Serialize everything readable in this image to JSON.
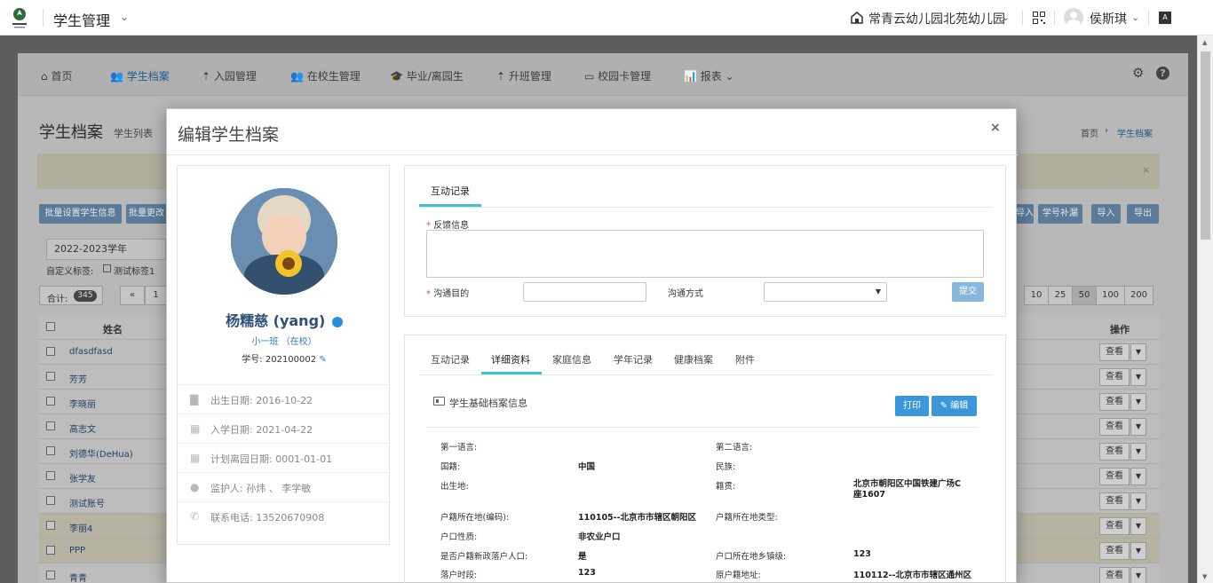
{
  "topbar": {
    "app_title": "学生管理",
    "school": "常青云幼儿园北苑幼儿园",
    "user": "侯斯琪"
  },
  "nav": {
    "items": [
      "首页",
      "学生档案",
      "入园管理",
      "在校生管理",
      "毕业/离园生",
      "升班管理",
      "校园卡管理",
      "报表"
    ]
  },
  "page": {
    "title": "学生档案",
    "subtitle": "学生列表",
    "breadcrumb_home": "首页",
    "breadcrumb_current": "学生档案",
    "btn_batch_set": "批量设置学生信息",
    "btn_batch_change": "批量更改",
    "btn_import_left": "导入",
    "btn_student_no": "学号补漏",
    "btn_import": "导入",
    "btn_export": "导出",
    "year_select": "2022-2023学年",
    "tag_label": "自定义标签:",
    "tag_option": "测试标签1",
    "total_label": "合计:",
    "total_count": "345",
    "page_prev": "«",
    "page_num": "1",
    "page_sizes": [
      "10",
      "25",
      "50",
      "100",
      "200"
    ],
    "col_name": "姓名",
    "col_action": "操作",
    "view_label": "查看",
    "students": [
      "dfasdfasd",
      "芳芳",
      "李晓丽",
      "高志文",
      "刘德华(DeHua)",
      "张学友",
      "测试账号",
      "李丽4",
      "PPP",
      "青青"
    ]
  },
  "modal": {
    "title": "编辑学生档案",
    "close": "×",
    "student": {
      "name": "杨糯慈 (yang)",
      "class": "小一班 （在校）",
      "no_label": "学号:",
      "no": "202100002",
      "birth_label": "出生日期:",
      "birth": "2016-10-22",
      "enroll_label": "入学日期:",
      "enroll": "2021-04-22",
      "leave_label": "计划离园日期:",
      "leave": "0001-01-01",
      "guardian_label": "监护人:",
      "guardian": "孙炜 、 李学敏",
      "phone_label": "联系电话:",
      "phone": "13520670908"
    },
    "feedback": {
      "tab": "互动记录",
      "info_label": "反馈信息",
      "purpose_label": "沟通目的",
      "method_label": "沟通方式",
      "submit": "提交"
    },
    "tabs": [
      "互动记录",
      "详细资料",
      "家庭信息",
      "学年记录",
      "健康档案",
      "附件"
    ],
    "detail": {
      "section_title": "学生基础档案信息",
      "print": "打印",
      "edit": "编辑",
      "fields": [
        {
          "label": "第一语言:",
          "value": "",
          "label2": "第二语言:",
          "value2": ""
        },
        {
          "label": "国籍:",
          "value": "中国",
          "label2": "民族:",
          "value2": ""
        },
        {
          "label": "出生地:",
          "value": "",
          "label2": "籍贯:",
          "value2": "北京市朝阳区中国铁建广场C座1607"
        },
        {
          "label": "户籍所在地(编码):",
          "value": "110105--北京市市辖区朝阳区",
          "label2": "户籍所在地类型:",
          "value2": ""
        },
        {
          "label": "户口性质:",
          "value": "非农业户口",
          "label2": "",
          "value2": ""
        },
        {
          "label": "是否户籍新政落户人口:",
          "value": "是",
          "label2": "户口所在地乡镇级:",
          "value2": "123"
        },
        {
          "label": "落户时段:",
          "value": "123",
          "label2": "原户籍地址:",
          "value2": "110112--北京市市辖区通州区"
        }
      ]
    }
  }
}
